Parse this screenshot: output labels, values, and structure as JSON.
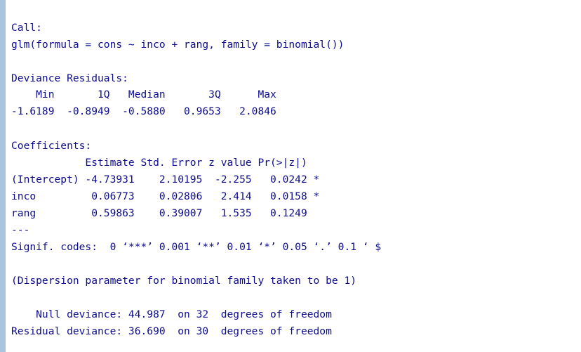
{
  "console": {
    "lines": [
      "Call:",
      "glm(formula = cons ~ inco + rang, family = binomial())",
      "Deviance Residuals:",
      "    Min       1Q   Median       3Q      Max  ",
      "-1.6189  -0.8949  -0.5880   0.9653   2.0846  ",
      "Coefficients:",
      "            Estimate Std. Error z value Pr(>|z|)  ",
      "(Intercept) -4.73931    2.10195  -2.255   0.0242 *",
      "inco         0.06773    0.02806   2.414   0.0158 *",
      "rang         0.59863    0.39007   1.535   0.1249  ",
      "---",
      "Signif. codes:  0 ‘***’ 0.001 ‘**’ 0.01 ‘*’ 0.05 ‘.’ 0.1 ‘ $",
      "(Dispersion parameter for binomial family taken to be 1)",
      "    Null deviance: 44.987  on 32  degrees of freedom",
      "Residual deviance: 36.690  on 30  degrees of freedom"
    ],
    "text_color": "#0d0d8c",
    "border_color": "#a9c4dc"
  }
}
